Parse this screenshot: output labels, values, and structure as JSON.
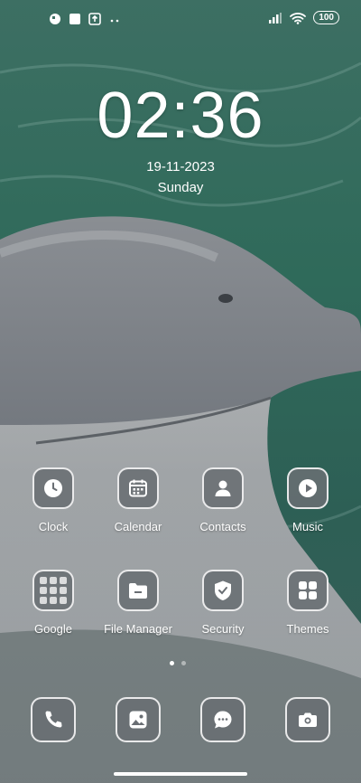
{
  "status_bar": {
    "left_icons": [
      "app-notification-icon",
      "square-notification-icon",
      "upload-notification-icon",
      "more-dots-icon"
    ],
    "right_icons": [
      "signal-icon",
      "wifi-icon"
    ],
    "battery": "100"
  },
  "clock": {
    "time": "02:36",
    "date": "19-11-2023",
    "day": "Sunday"
  },
  "apps": [
    {
      "label": "Clock",
      "icon": "clock-icon"
    },
    {
      "label": "Calendar",
      "icon": "calendar-icon"
    },
    {
      "label": "Contacts",
      "icon": "contacts-icon"
    },
    {
      "label": "Music",
      "icon": "play-icon"
    },
    {
      "label": "Google",
      "icon": "folder-icon"
    },
    {
      "label": "File Manager",
      "icon": "file-folder-icon"
    },
    {
      "label": "Security",
      "icon": "shield-icon"
    },
    {
      "label": "Themes",
      "icon": "grid-icon"
    }
  ],
  "dock": [
    {
      "icon": "phone-icon"
    },
    {
      "icon": "gallery-icon"
    },
    {
      "icon": "messages-icon"
    },
    {
      "icon": "camera-icon"
    }
  ],
  "page_indicator": {
    "current": 1,
    "total": 2
  }
}
